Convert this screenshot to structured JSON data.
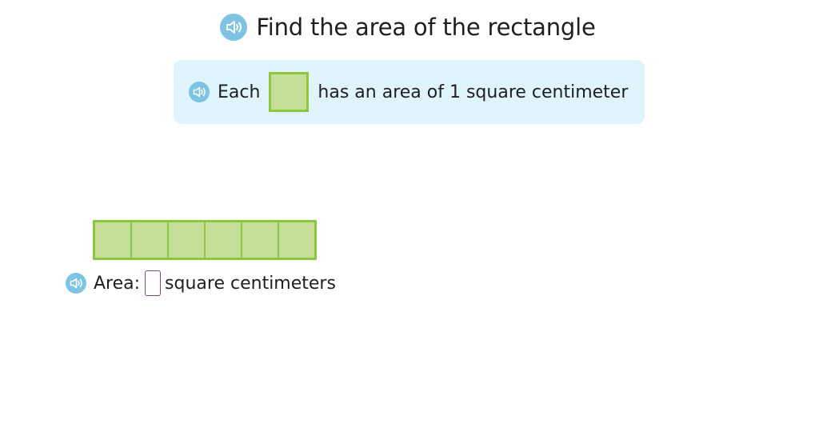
{
  "title": {
    "text": "Find the area of the rectangle",
    "speaker_icon": "speaker-icon"
  },
  "info": {
    "before": "Each",
    "after": "has an area of 1 square centimeter",
    "speaker_icon": "speaker-icon"
  },
  "rectangle": {
    "columns": 6,
    "rows": 1
  },
  "answer": {
    "label": "Area:",
    "value": "",
    "unit": "square centimeters",
    "speaker_icon": "speaker-icon"
  },
  "colors": {
    "square_fill": "#c5df98",
    "square_border": "#8dc63f",
    "info_bg": "#dff4fc",
    "speaker_bg": "#7cc3e4",
    "input_border": "#7d4a7d"
  }
}
